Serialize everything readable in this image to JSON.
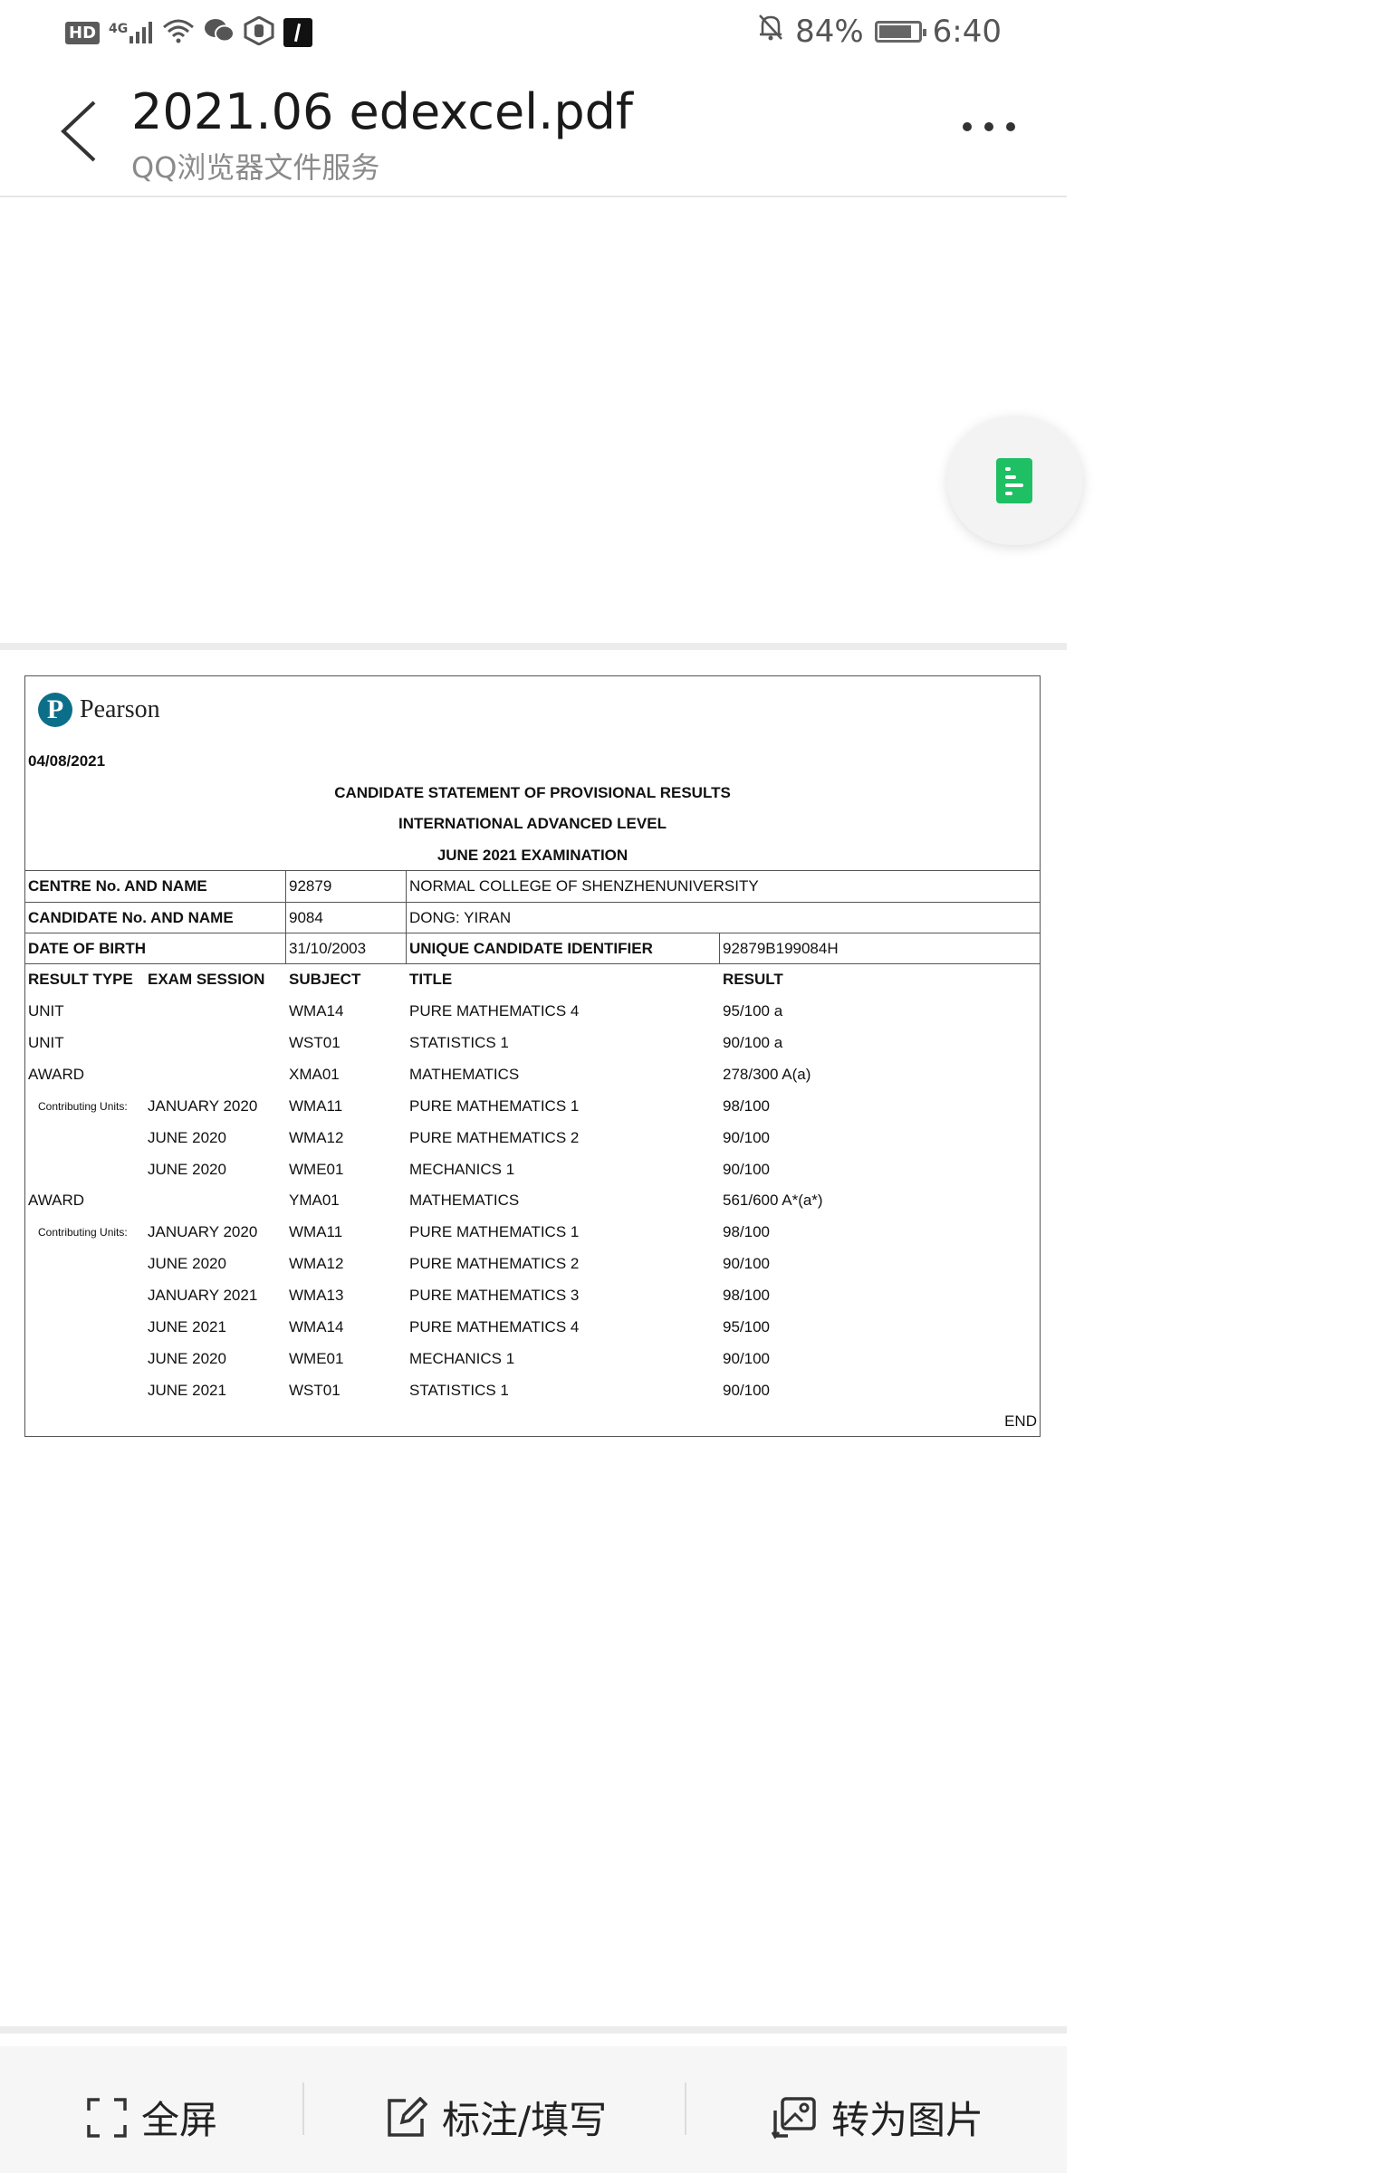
{
  "status_bar": {
    "hd": "HD",
    "network": "4G",
    "battery": "84%",
    "battery_level": 0.84,
    "time": "6:40",
    "icons": [
      "hd-icon",
      "signal-icon",
      "wifi-icon",
      "wechat-icon",
      "hand-icon",
      "app-icon",
      "mute-bell-icon",
      "battery-icon"
    ]
  },
  "header": {
    "title": "2021.06 edexcel.pdf",
    "subtitle": "QQ浏览器文件服务"
  },
  "document": {
    "logo": "Pearson",
    "date": "04/08/2021",
    "heading1": "CANDIDATE STATEMENT OF PROVISIONAL RESULTS",
    "heading2": "INTERNATIONAL ADVANCED LEVEL",
    "heading3": "JUNE 2021 EXAMINATION",
    "centre_label": "CENTRE No. AND NAME",
    "centre_no": "92879",
    "centre_name": "NORMAL COLLEGE OF SHENZHENUNIVERSITY",
    "candidate_label": "CANDIDATE No. AND NAME",
    "candidate_no": "9084",
    "candidate_name": "DONG: YIRAN",
    "dob_label": "DATE OF BIRTH",
    "dob": "31/10/2003",
    "uci_label": "UNIQUE CANDIDATE IDENTIFIER",
    "uci": "92879B199084H",
    "col_headers": {
      "result_type": "RESULT TYPE",
      "exam_session": "EXAM SESSION",
      "subject": "SUBJECT",
      "title": "TITLE",
      "result": "RESULT"
    },
    "rows": [
      {
        "type": "UNIT",
        "session": "",
        "subject": "WMA14",
        "title": "PURE MATHEMATICS 4",
        "result": "95/100 a"
      },
      {
        "type": "UNIT",
        "session": "",
        "subject": "WST01",
        "title": "STATISTICS 1",
        "result": "90/100 a"
      },
      {
        "type": "AWARD",
        "session": "",
        "subject": "XMA01",
        "title": "MATHEMATICS",
        "result": "278/300 A(a)"
      },
      {
        "type": "Contributing Units:",
        "session": "JANUARY 2020",
        "subject": "WMA11",
        "title": "PURE MATHEMATICS 1",
        "result": "98/100"
      },
      {
        "type": "",
        "session": "JUNE 2020",
        "subject": "WMA12",
        "title": "PURE MATHEMATICS 2",
        "result": "90/100"
      },
      {
        "type": "",
        "session": "JUNE 2020",
        "subject": "WME01",
        "title": "MECHANICS 1",
        "result": "90/100"
      },
      {
        "type": "AWARD",
        "session": "",
        "subject": "YMA01",
        "title": "MATHEMATICS",
        "result": "561/600 A*(a*)"
      },
      {
        "type": "Contributing Units:",
        "session": "JANUARY 2020",
        "subject": "WMA11",
        "title": "PURE MATHEMATICS 1",
        "result": "98/100"
      },
      {
        "type": "",
        "session": "JUNE 2020",
        "subject": "WMA12",
        "title": "PURE MATHEMATICS 2",
        "result": "90/100"
      },
      {
        "type": "",
        "session": "JANUARY 2021",
        "subject": "WMA13",
        "title": "PURE MATHEMATICS 3",
        "result": "98/100"
      },
      {
        "type": "",
        "session": "JUNE 2021",
        "subject": "WMA14",
        "title": "PURE MATHEMATICS 4",
        "result": "95/100"
      },
      {
        "type": "",
        "session": "JUNE 2020",
        "subject": "WME01",
        "title": "MECHANICS 1",
        "result": "90/100"
      },
      {
        "type": "",
        "session": "JUNE 2021",
        "subject": "WST01",
        "title": "STATISTICS 1",
        "result": "90/100"
      }
    ],
    "end": "END"
  },
  "toolbar": {
    "fullscreen": "全屏",
    "annotate": "标注/填写",
    "to_image": "转为图片"
  }
}
